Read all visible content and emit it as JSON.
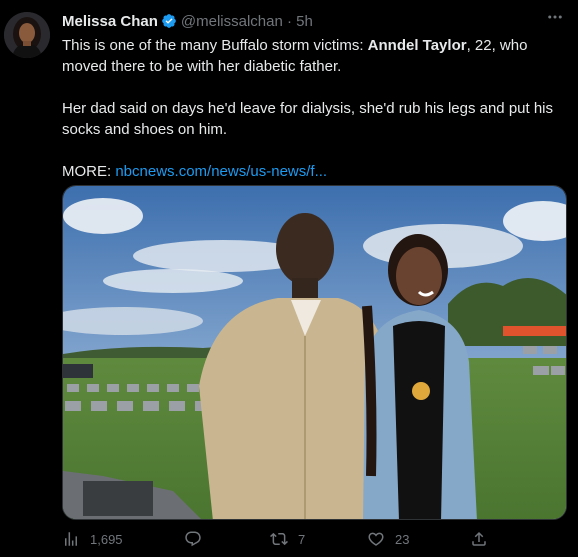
{
  "author": {
    "name": "Melissa Chan",
    "handle": "@melissalchan",
    "separator": "·",
    "time": "5h"
  },
  "more_icon": "more-horizontal-icon",
  "text": {
    "p1_prefix": "This is one of the many Buffalo storm victims: ",
    "p1_bold": "Anndel Taylor",
    "p1_suffix": ", 22, who moved there to be with her diabetic father.",
    "p2": "Her dad said on days he'd leave for dialysis, she'd rub his legs and put his socks and shoes on him.",
    "p3_label": "MORE: ",
    "p3_link": "nbcnews.com/news/us-news/f..."
  },
  "actions": {
    "views": "1,695",
    "reply": "",
    "retweets": "7",
    "likes": "23",
    "share": ""
  },
  "colors": {
    "background": "#000000",
    "text": "#e7e9ea",
    "secondary": "#71767b",
    "link": "#1d9bf0",
    "verified": "#1d9bf0"
  }
}
